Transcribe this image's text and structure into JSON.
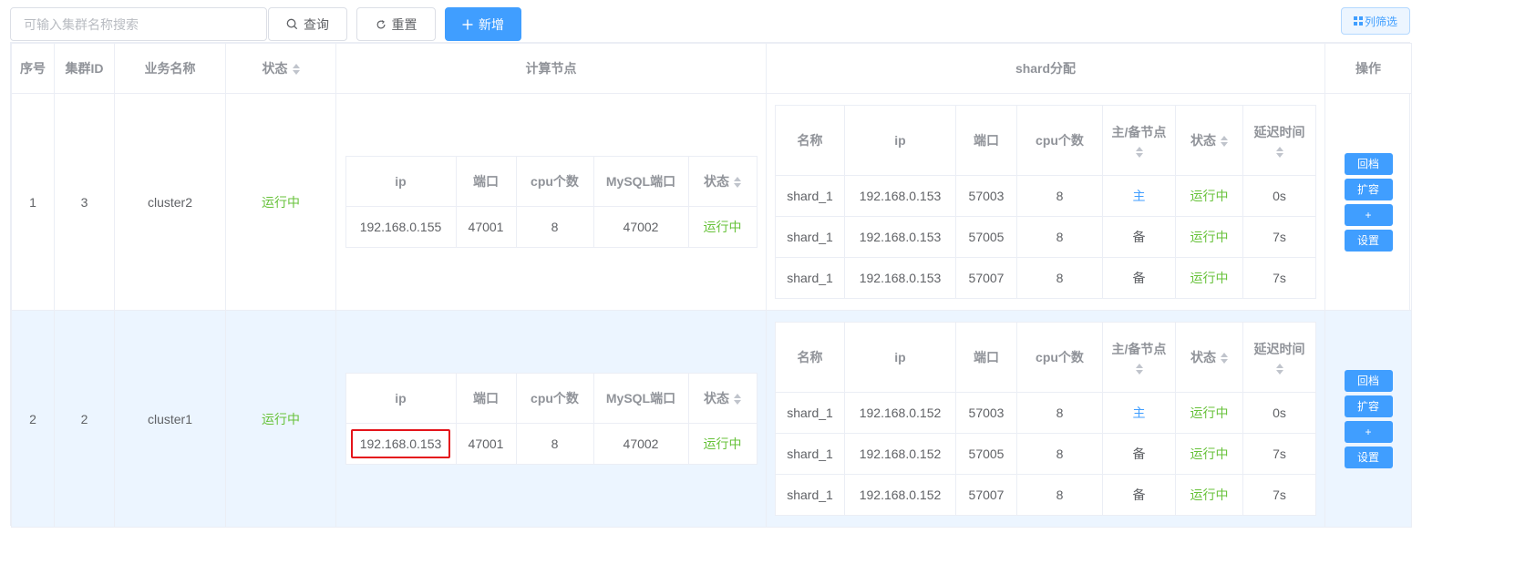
{
  "toolbar": {
    "search_placeholder": "可输入集群名称搜索",
    "query_label": "查询",
    "reset_label": "重置",
    "add_label": "新增",
    "filter_label": "列筛选"
  },
  "table": {
    "headers": {
      "index": "序号",
      "cluster_id": "集群ID",
      "business_name": "业务名称",
      "status": "状态",
      "compute_nodes": "计算节点",
      "shard_alloc": "shard分配",
      "actions": "操作"
    },
    "compute_headers": [
      "ip",
      "端口",
      "cpu个数",
      "MySQL端口",
      "状态"
    ],
    "shard_headers": [
      "名称",
      "ip",
      "端口",
      "cpu个数",
      "主/备节点",
      "状态",
      "延迟时间"
    ],
    "action_labels": [
      "回档",
      "扩容",
      "+",
      "设置"
    ],
    "rows": [
      {
        "index": "1",
        "cluster_id": "3",
        "business_name": "cluster2",
        "status": "运行中",
        "compute": [
          [
            "192.168.0.155",
            "47001",
            "8",
            "47002",
            "运行中"
          ]
        ],
        "shards": [
          [
            "shard_1",
            "192.168.0.153",
            "57003",
            "8",
            "主",
            "运行中",
            "0s"
          ],
          [
            "shard_1",
            "192.168.0.153",
            "57005",
            "8",
            "备",
            "运行中",
            "7s"
          ],
          [
            "shard_1",
            "192.168.0.153",
            "57007",
            "8",
            "备",
            "运行中",
            "7s"
          ]
        ]
      },
      {
        "index": "2",
        "cluster_id": "2",
        "business_name": "cluster1",
        "status": "运行中",
        "compute": [
          [
            "192.168.0.153",
            "47001",
            "8",
            "47002",
            "运行中"
          ]
        ],
        "shards": [
          [
            "shard_1",
            "192.168.0.152",
            "57003",
            "8",
            "主",
            "运行中",
            "0s"
          ],
          [
            "shard_1",
            "192.168.0.152",
            "57005",
            "8",
            "备",
            "运行中",
            "7s"
          ],
          [
            "shard_1",
            "192.168.0.152",
            "57007",
            "8",
            "备",
            "运行中",
            "7s"
          ]
        ]
      }
    ]
  },
  "colors": {
    "primary": "#409eff",
    "success": "#67c23a",
    "highlight_border": "#e4141b",
    "row_alt_bg": "#ecf5ff"
  }
}
